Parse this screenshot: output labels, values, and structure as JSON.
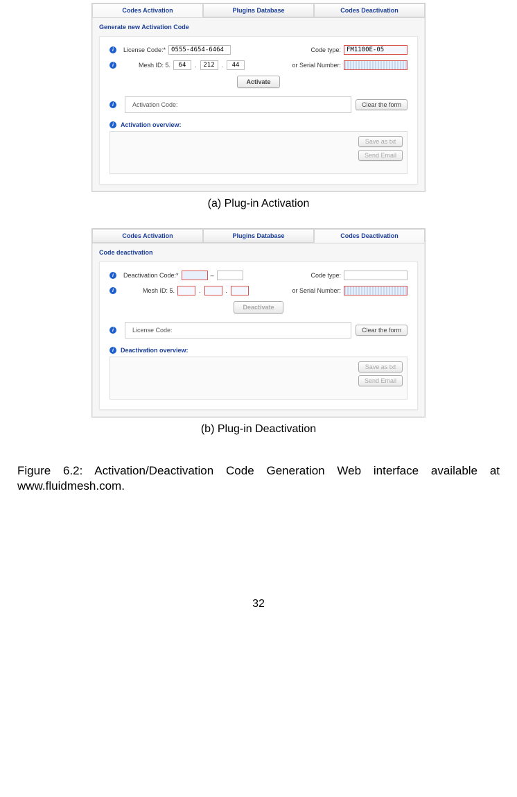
{
  "panel_a": {
    "tabs": {
      "t1": "Codes Activation",
      "t2": "Plugins Database",
      "t3": "Codes Deactivation"
    },
    "section_title": "Generate new Activation Code",
    "license_label": "License Code:*",
    "license_value": "0555-4654-6464",
    "code_type_label": "Code type:",
    "code_type_value": "FM1100E-05",
    "mesh_label": "Mesh ID: 5.",
    "mesh_a": "64",
    "mesh_b": "212",
    "mesh_c": "44",
    "serial_label": "or Serial Number:",
    "activate_btn": "Activate",
    "activation_code_label": "Activation Code:",
    "clear_btn": "Clear the form",
    "overview_label": "Activation overview:",
    "save_txt_btn": "Save as txt",
    "send_email_btn": "Send Email"
  },
  "panel_b": {
    "tabs": {
      "t1": "Codes Activation",
      "t2": "Plugins Database",
      "t3": "Codes Deactivation"
    },
    "section_title": "Code deactivation",
    "deact_code_label": "Deactivation Code:*",
    "code_type_label": "Code type:",
    "mesh_label": "Mesh ID: 5.",
    "serial_label": "or Serial Number:",
    "deactivate_btn": "Deactivate",
    "license_code_label": "License Code:",
    "clear_btn": "Clear the form",
    "overview_label": "Deactivation overview:",
    "save_txt_btn": "Save as txt",
    "send_email_btn": "Send Email"
  },
  "caption_a": "(a)  Plug-in Activation",
  "caption_b": "(b)  Plug-in Deactivation",
  "figure_caption": "Figure 6.2:  Activation/Deactivation Code Generation Web interface available at www.fluidmesh.com.",
  "page_number": "32",
  "dash": "–",
  "dot": "."
}
